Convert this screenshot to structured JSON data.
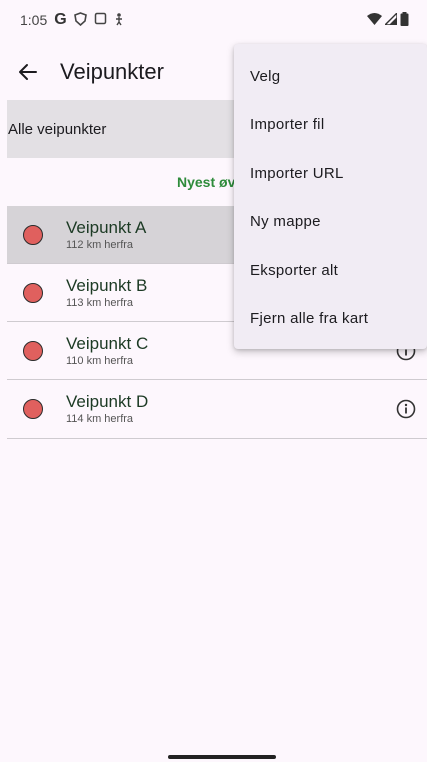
{
  "status_bar": {
    "time": "1:05",
    "g_label": "G"
  },
  "app_bar": {
    "title": "Veipunkter"
  },
  "filter": {
    "label": "Alle veipunkter"
  },
  "sort": {
    "label": "Nyest øv"
  },
  "waypoints": [
    {
      "name": "Veipunkt A",
      "distance": "112 km herfra",
      "color": "#e0605e",
      "selected": true
    },
    {
      "name": "Veipunkt B",
      "distance": "113 km herfra",
      "color": "#e0605e",
      "selected": false
    },
    {
      "name": "Veipunkt C",
      "distance": "110 km herfra",
      "color": "#e0605e",
      "selected": false
    },
    {
      "name": "Veipunkt D",
      "distance": "114 km herfra",
      "color": "#e0605e",
      "selected": false
    }
  ],
  "menu": {
    "items": [
      {
        "label": "Velg"
      },
      {
        "label": "Importer fil"
      },
      {
        "label": "Importer URL"
      },
      {
        "label": "Ny mappe"
      },
      {
        "label": "Eksporter alt"
      },
      {
        "label": "Fjern alle fra kart"
      }
    ]
  },
  "colors": {
    "accent_green": "#2e8b3b",
    "marker_red": "#e0605e",
    "menu_bg": "#f1ecf4"
  },
  "icons": [
    "back-arrow-icon",
    "info-icon",
    "wifi-icon",
    "signal-icon",
    "battery-icon"
  ]
}
